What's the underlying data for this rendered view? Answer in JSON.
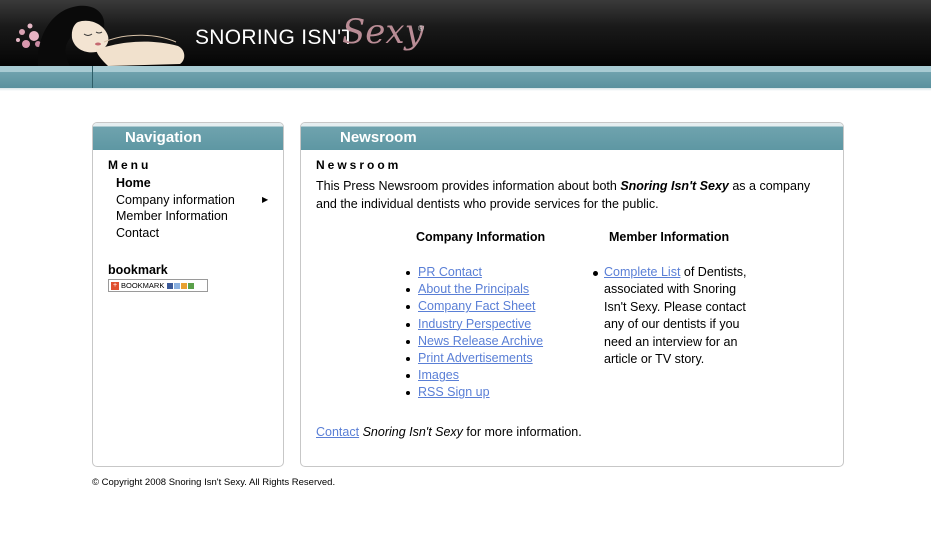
{
  "header": {
    "logo_text_main": "SNORING ISN'T",
    "logo_text_script": "Sexy",
    "logo_registered": "®"
  },
  "nav": {
    "title": "Navigation",
    "menu_title": "Menu",
    "items": [
      {
        "label": "Home",
        "bold": true
      },
      {
        "label": "Company information",
        "has_submenu": true
      },
      {
        "label": "Member Information"
      },
      {
        "label": "Contact"
      }
    ],
    "bookmark_title": "bookmark",
    "bookmark_button": "BOOKMARK"
  },
  "newsroom": {
    "panel_title": "Newsroom",
    "heading": "Newsroom",
    "intro_before": "This Press Newsroom provides information about both ",
    "intro_brand": "Snoring Isn't Sexy",
    "intro_after": " as a company and the individual dentists who provide services for the public.",
    "company_col_title": "Company Information",
    "member_col_title": "Member Information",
    "company_links": [
      "PR Contact",
      "About the Principals",
      "Company Fact Sheet",
      "Industry Perspective",
      "News Release Archive",
      "Print Advertisements",
      "Images",
      "RSS Sign up"
    ],
    "member_link": "Complete List",
    "member_text": " of Dentists, associated with Snoring Isn't Sexy. Please contact any of our dentists if you need an interview for an article or TV story.",
    "footer_link": "Contact",
    "footer_brand": "Snoring Isn't Sexy",
    "footer_after": " for more information."
  },
  "copyright": "© Copyright 2008 Snoring Isn't Sexy. All Rights Reserved.",
  "colors": {
    "header_bg": "#111111",
    "teal": "#5e97a3",
    "link": "#5a7fd6",
    "logo_script": "#b98c95"
  }
}
